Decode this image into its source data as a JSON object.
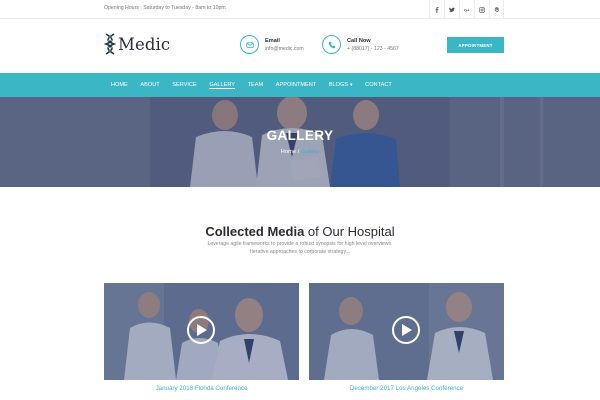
{
  "topbar": {
    "hours": "Opening Hours : Saturday to Tuesday - 8am to 10pm",
    "socials": [
      "facebook-icon",
      "twitter-icon",
      "google-plus-icon",
      "instagram-icon",
      "pinterest-icon"
    ],
    "social_glyphs": [
      "f",
      "",
      "G+",
      "",
      ""
    ]
  },
  "header": {
    "logo_text": "Medic",
    "email_label": "Email",
    "email_value": "info@medic.com",
    "call_label": "Call Now",
    "call_value": "+ (88017) - 123 - 4567",
    "appointment_button": "APPOINTMENT"
  },
  "nav": {
    "items": [
      {
        "label": "HOME"
      },
      {
        "label": "ABOUT"
      },
      {
        "label": "SERVICE"
      },
      {
        "label": "GALLERY"
      },
      {
        "label": "TEAM"
      },
      {
        "label": "APPOINTMENT"
      },
      {
        "label": "BLOGS"
      },
      {
        "label": "CONTACT"
      }
    ],
    "active": "GALLERY"
  },
  "hero": {
    "title": "GALLERY",
    "breadcrumb_home": "Home",
    "breadcrumb_sep": "/",
    "breadcrumb_current": "Gallery"
  },
  "section": {
    "title_bold": "Collected Media",
    "title_rest": " of Our Hospital",
    "description": "Leverage agile frameworks to provide a robust synopsis for high level overviews. Iterative approaches to corporate strategy..."
  },
  "gallery": [
    {
      "caption": "January 2018 Florida Conference"
    },
    {
      "caption": "December 2017 Los Angeles Conference"
    }
  ],
  "colors": {
    "accent": "#3bb6c4",
    "dark_text": "#2b2b36"
  }
}
